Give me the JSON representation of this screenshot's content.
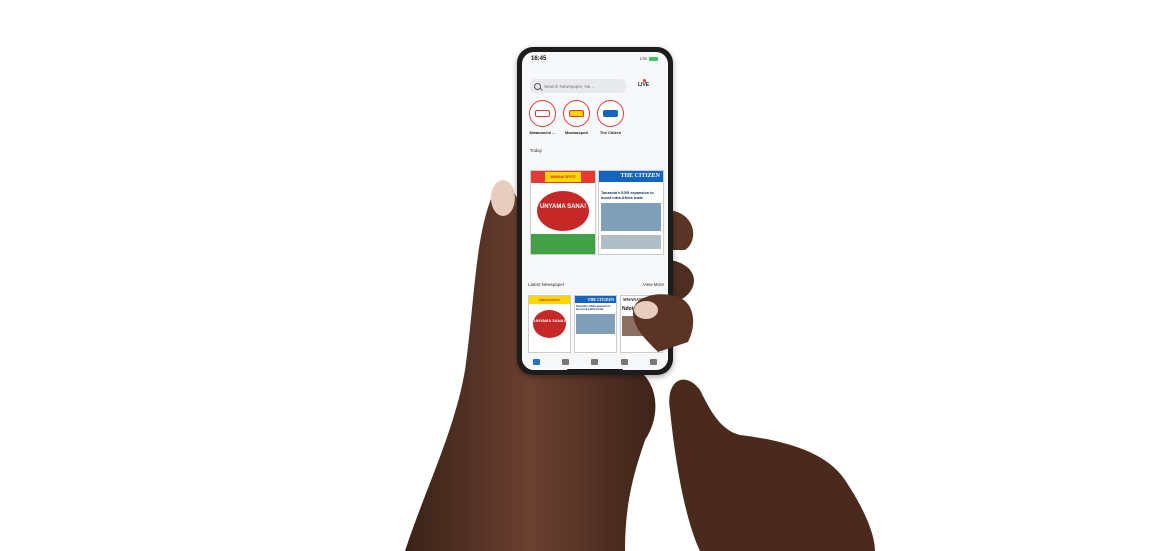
{
  "status_bar": {
    "time": "16:45",
    "signal": "LTE"
  },
  "search": {
    "placeholder": "Search Newspaper, Ne..."
  },
  "live_label": "LIVE",
  "publications": [
    {
      "label": "Mwananchi ..."
    },
    {
      "label": "Mwanaspoti"
    },
    {
      "label": "The Citizen"
    }
  ],
  "today_label": "Today",
  "today_papers": [
    {
      "masthead": "MWANA SPOTI",
      "headline": "UNYAMA SANA!"
    },
    {
      "masthead": "THE CITIZEN",
      "headline": "Tanzania's SGR expansion to boost intra-Africa trade"
    }
  ],
  "latest_section": {
    "title": "Latest Newspaper",
    "view_more": "View More"
  },
  "latest_papers": [
    {
      "masthead": "MWANASPOTI",
      "headline": "UNYAMA SANA!"
    },
    {
      "masthead": "THE CITIZEN",
      "headline": "Tanzania's SGR expansion to boost intra-Africa trade"
    },
    {
      "masthead": "MWANANCHI",
      "headline": "Ndoto"
    }
  ],
  "colors": {
    "accent": "#e53935",
    "active_tab": "#1e73d8",
    "citizen_blue": "#1565c0",
    "spoti_yellow": "#ffd600"
  },
  "tabs": [
    "home-icon",
    "newspaper-icon",
    "bell-icon",
    "library-icon",
    "gear-icon"
  ]
}
